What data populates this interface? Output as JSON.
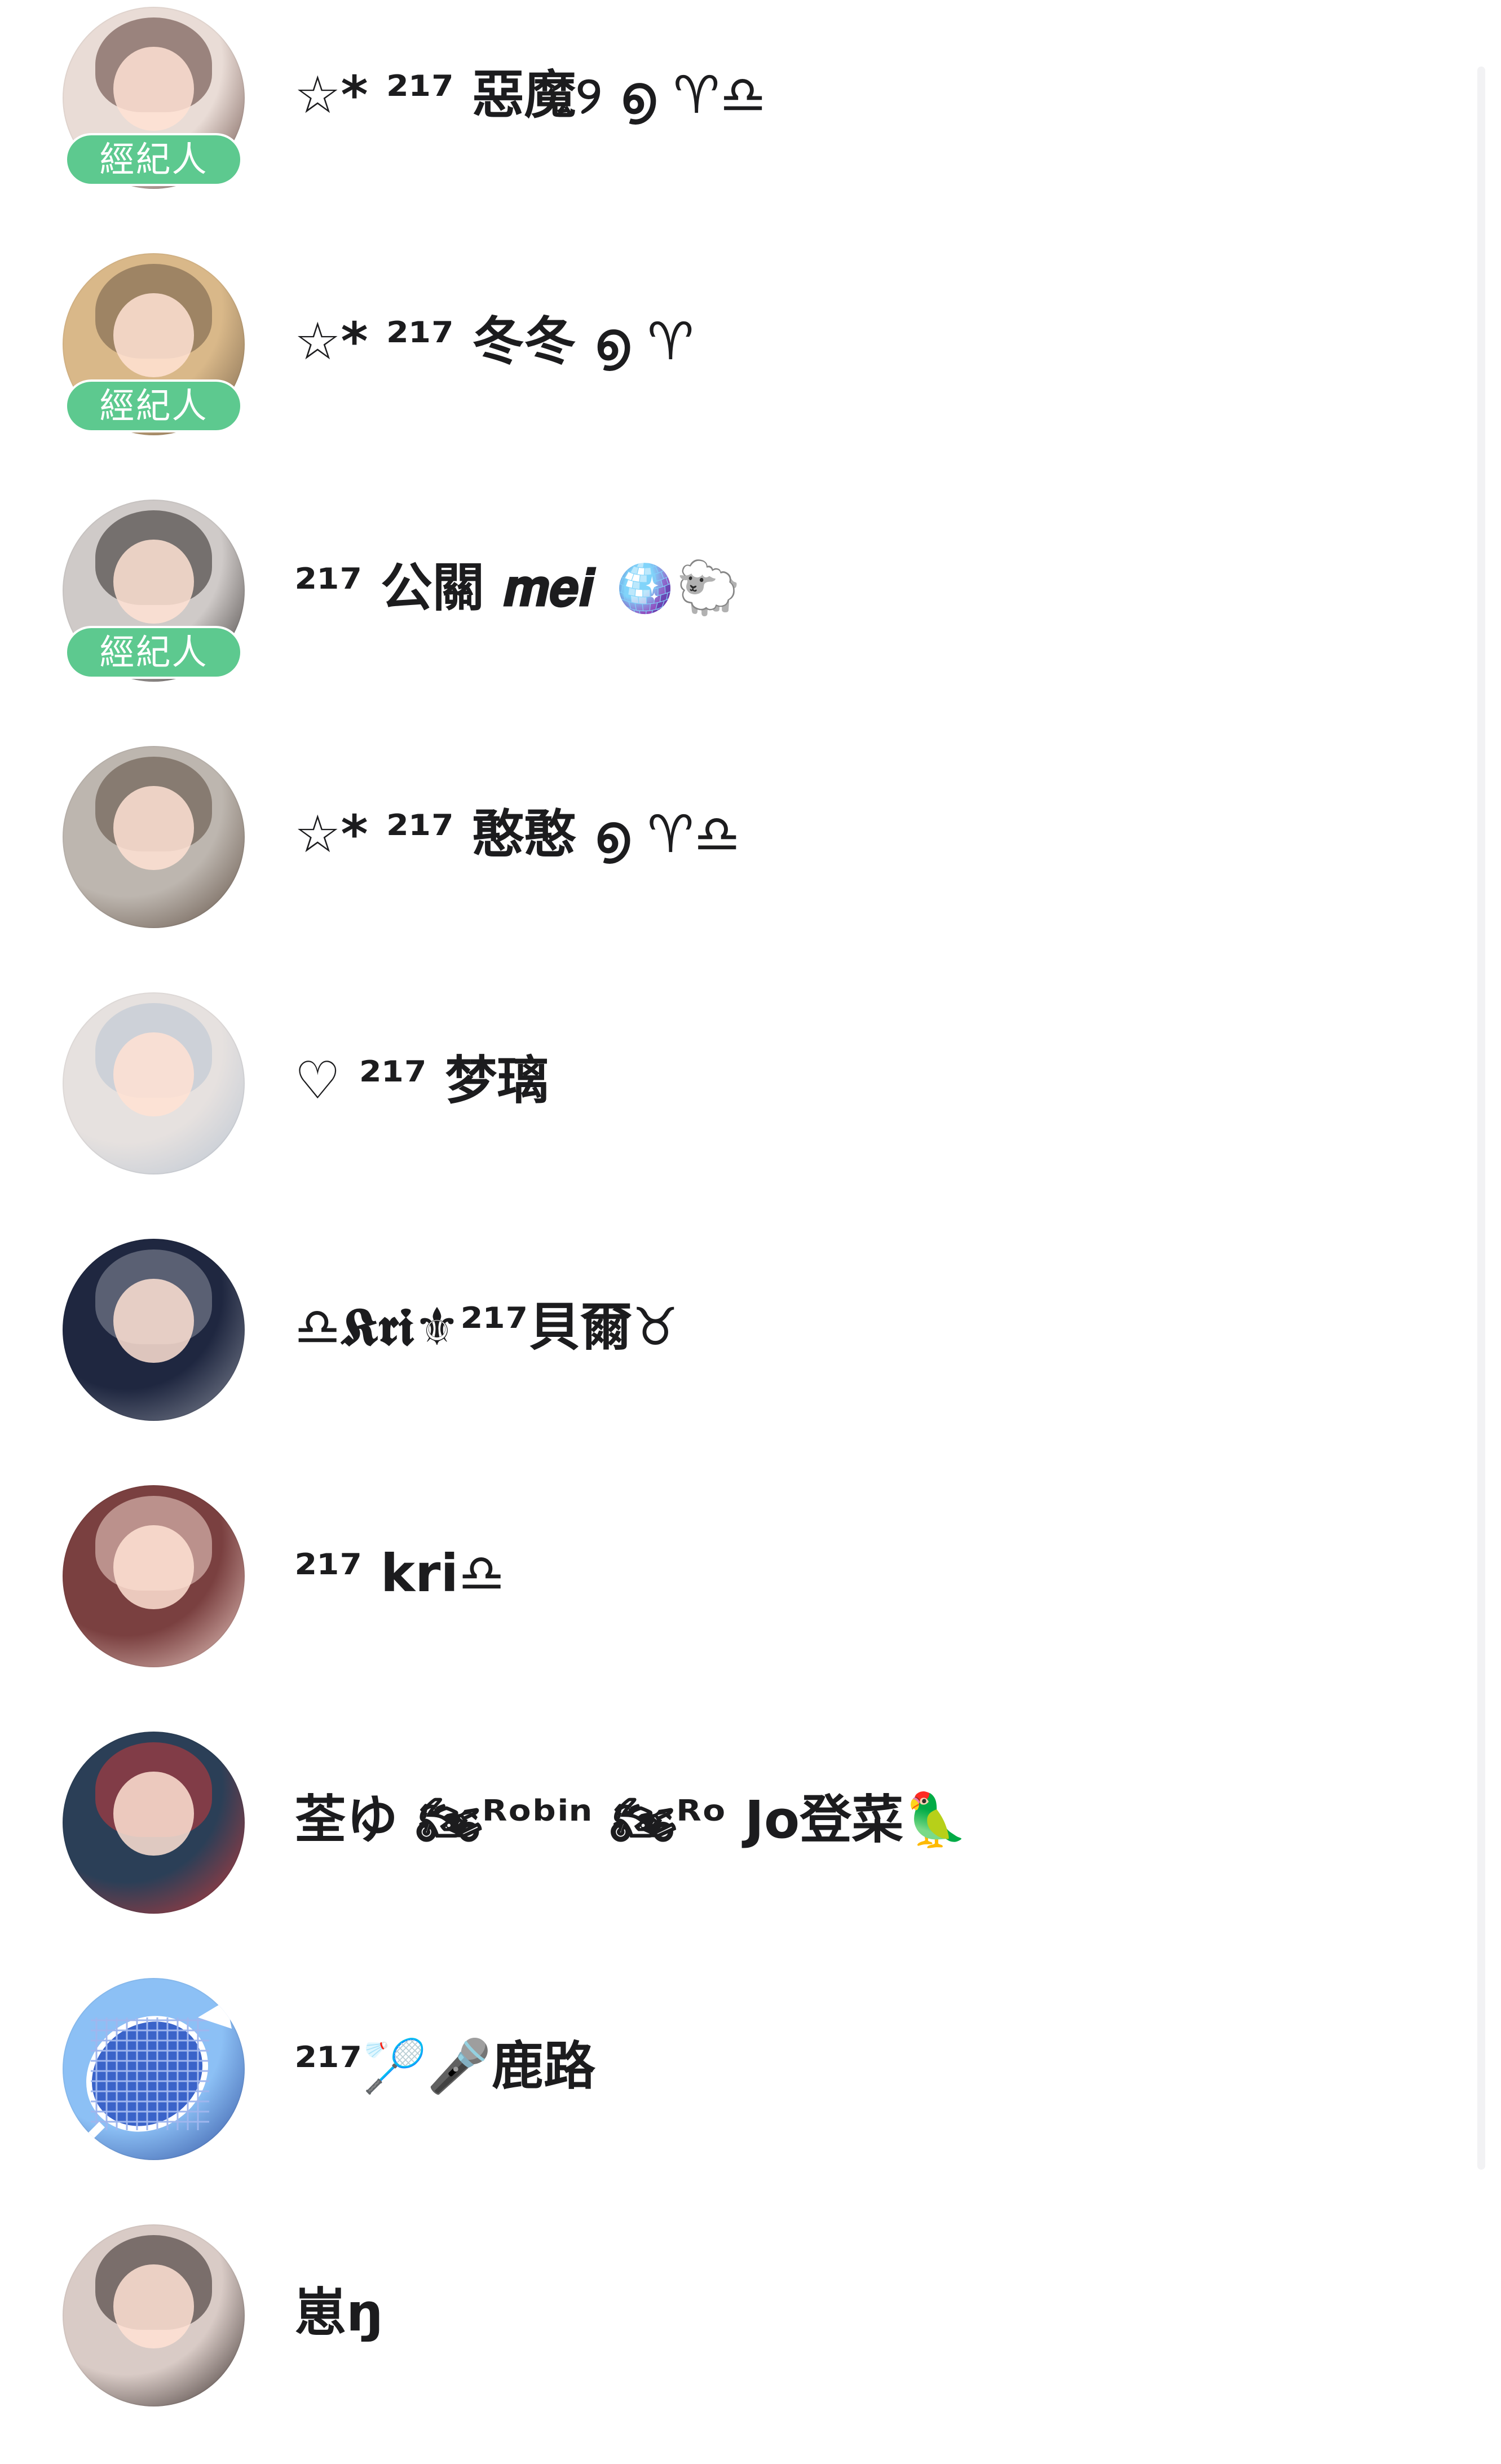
{
  "contacts": [
    {
      "name": "☆* ²¹⁷ 惡魔୨ ൭ ♈︎♎",
      "badge": "經紀人",
      "avatar": {
        "icon": "avatar-doll-girl",
        "bg": "#e9dcd6",
        "accent": "#5a3b34"
      }
    },
    {
      "name": "☆* ²¹⁷ 冬冬 ൭ ♈︎",
      "badge": "經紀人",
      "avatar": {
        "icon": "avatar-cat",
        "bg": "#d9b889",
        "accent": "#6d5a45"
      }
    },
    {
      "name": "²¹⁷ 公關 𝒎𝒆𝒊 🪩🐑",
      "badge": "經紀人",
      "avatar": {
        "icon": "avatar-girl-mirror",
        "bg": "#cfcac8",
        "accent": "#2b2624"
      }
    },
    {
      "name": "☆* ²¹⁷ 憨憨 ൭ ♈︎♎",
      "badge": "",
      "avatar": {
        "icon": "avatar-monkey-shirt",
        "bg": "#bdb6af",
        "accent": "#5b4a3e"
      }
    },
    {
      "name": "♡ ²¹⁷ 梦璃",
      "badge": "",
      "avatar": {
        "icon": "avatar-illustrated-girl",
        "bg": "#e6e1df",
        "accent": "#b8c4d2"
      }
    },
    {
      "name": "♎𝕶𝖗𝖎⚜²¹⁷貝爾♉",
      "badge": "",
      "avatar": {
        "icon": "avatar-night-sky",
        "bg": "#1f2740",
        "accent": "#8a8f9c"
      }
    },
    {
      "name": "²¹⁷ kri♎",
      "badge": "",
      "avatar": {
        "icon": "avatar-red-hair-girl",
        "bg": "#7a4040",
        "accent": "#f0d3cb"
      }
    },
    {
      "name": "荃ゆ 🏍ᴿᵒᵇⁱⁿ 🏍ᴿᵒ Jo登菜🦜",
      "badge": "",
      "avatar": {
        "icon": "avatar-city-tower",
        "bg": "#2b3f57",
        "accent": "#c83a3a"
      }
    },
    {
      "name": "²¹⁷🏸🎤鹿路",
      "badge": "",
      "avatar": {
        "icon": "badminton-racket-icon",
        "bg": "#8cc0f5",
        "accent": "#2c4a9a"
      }
    },
    {
      "name": "崽ŋ",
      "badge": "",
      "avatar": {
        "icon": "avatar-girl-portrait",
        "bg": "#d9cbc6",
        "accent": "#2c2220"
      }
    }
  ],
  "colors": {
    "badge": "#5dc98f",
    "name_text": "#1c1c1e",
    "background": "#ffffff"
  }
}
